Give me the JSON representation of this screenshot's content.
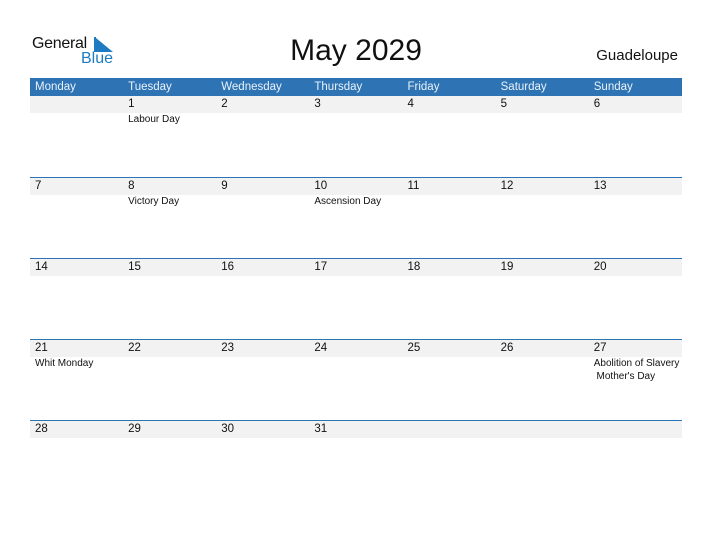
{
  "logo": {
    "general": "General",
    "blue": "Blue"
  },
  "title": "May 2029",
  "country": "Guadeloupe",
  "weekdays": [
    "Monday",
    "Tuesday",
    "Wednesday",
    "Thursday",
    "Friday",
    "Saturday",
    "Sunday"
  ],
  "weeks": [
    {
      "days": [
        "",
        "1",
        "2",
        "3",
        "4",
        "5",
        "6"
      ],
      "events": [
        "",
        "Labour Day",
        "",
        "",
        "",
        "",
        ""
      ]
    },
    {
      "days": [
        "7",
        "8",
        "9",
        "10",
        "11",
        "12",
        "13"
      ],
      "events": [
        "",
        "Victory Day",
        "",
        "Ascension Day",
        "",
        "",
        ""
      ]
    },
    {
      "days": [
        "14",
        "15",
        "16",
        "17",
        "18",
        "19",
        "20"
      ],
      "events": [
        "",
        "",
        "",
        "",
        "",
        "",
        ""
      ]
    },
    {
      "days": [
        "21",
        "22",
        "23",
        "24",
        "25",
        "26",
        "27"
      ],
      "events": [
        "Whit Monday",
        "",
        "",
        "",
        "",
        "",
        "Abolition of Slavery\n Mother's Day"
      ]
    },
    {
      "days": [
        "28",
        "29",
        "30",
        "31",
        "",
        "",
        ""
      ],
      "events": [
        "",
        "",
        "",
        "",
        "",
        "",
        ""
      ]
    }
  ],
  "colors": {
    "accent": "#2e73b3",
    "logo_blue": "#1f7bc1",
    "row_shade": "#f2f2f2"
  }
}
